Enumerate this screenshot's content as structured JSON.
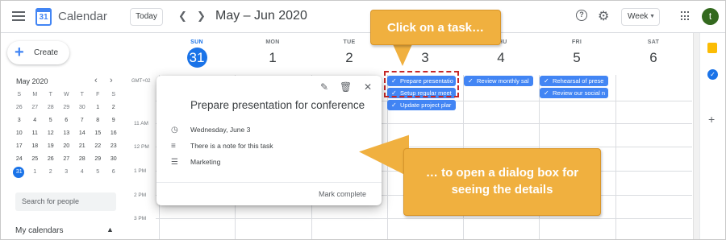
{
  "header": {
    "app_title": "Calendar",
    "logo_text": "31",
    "today_label": "Today",
    "date_range": "May – Jun 2020",
    "view_label": "Week",
    "avatar_letter": "t"
  },
  "sidebar": {
    "create_label": "Create",
    "mini_month": "May 2020",
    "weekday_initials": [
      "S",
      "M",
      "T",
      "W",
      "T",
      "F",
      "S"
    ],
    "mini_days": [
      [
        "26",
        "27",
        "28",
        "29",
        "30",
        "1",
        "2"
      ],
      [
        "3",
        "4",
        "5",
        "6",
        "7",
        "8",
        "9"
      ],
      [
        "10",
        "11",
        "12",
        "13",
        "14",
        "15",
        "16"
      ],
      [
        "17",
        "18",
        "19",
        "20",
        "21",
        "22",
        "23"
      ],
      [
        "24",
        "25",
        "26",
        "27",
        "28",
        "29",
        "30"
      ],
      [
        "31",
        "1",
        "2",
        "3",
        "4",
        "5",
        "6"
      ]
    ],
    "search_placeholder": "Search for people",
    "my_calendars_label": "My calendars"
  },
  "week": {
    "timezone": "GMT+02",
    "days": [
      {
        "dow": "SUN",
        "num": "31"
      },
      {
        "dow": "MON",
        "num": "1"
      },
      {
        "dow": "TUE",
        "num": "2"
      },
      {
        "dow": "WED",
        "num": "3"
      },
      {
        "dow": "THU",
        "num": "4"
      },
      {
        "dow": "FRI",
        "num": "5"
      },
      {
        "dow": "SAT",
        "num": "6"
      }
    ],
    "hours": [
      "11 AM",
      "12 PM",
      "1 PM",
      "2 PM",
      "3 PM"
    ]
  },
  "tasks": {
    "wed": [
      "Prepare presentatio",
      "Setup regular meet",
      "Update project plar"
    ],
    "thu": [
      "Review monthly sal"
    ],
    "fri": [
      "Rehearsal of prese",
      "Review our social n"
    ]
  },
  "dialog": {
    "title": "Prepare presentation for conference",
    "date": "Wednesday, June 3",
    "note": "There is a note for this task",
    "list": "Marketing",
    "complete_label": "Mark complete"
  },
  "callouts": {
    "top": "Click on a task…",
    "bottom_line1": "… to open a dialog box for",
    "bottom_line2": "seeing the details"
  },
  "colors": {
    "accent": "#1a73e8",
    "task": "#4285f4",
    "callout": "#f0b03f",
    "highlight": "#c62828"
  },
  "icons": [
    "menu-icon",
    "calendar-logo-icon",
    "chevron-left-icon",
    "chevron-right-icon",
    "help-icon",
    "gear-icon",
    "apps-grid-icon",
    "plus-icon",
    "pencil-icon",
    "trash-icon",
    "close-icon",
    "clock-icon",
    "notes-icon",
    "list-icon",
    "check-icon",
    "keep-icon",
    "tasks-icon"
  ]
}
